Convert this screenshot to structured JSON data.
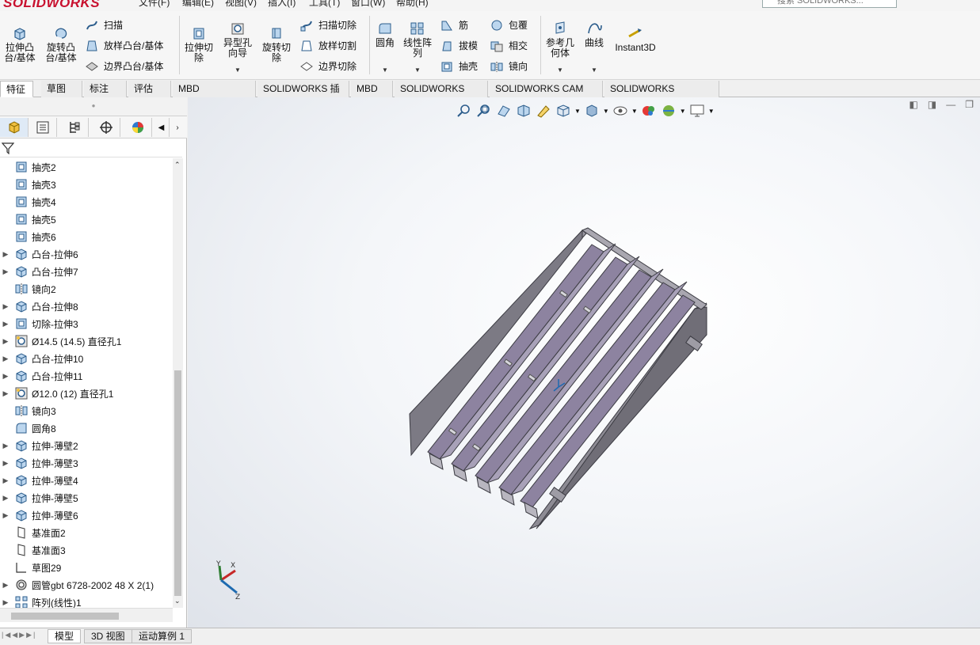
{
  "app": {
    "logo_text": "SOLIDWORKS"
  },
  "menu": {
    "items": [
      "文件(F)",
      "编辑(E)",
      "视图(V)",
      "插入(I)",
      "工具(T)",
      "窗口(W)",
      "帮助(H)"
    ]
  },
  "search": {
    "placeholder": "搜索 SOLIDWORKS..."
  },
  "ribbon": {
    "extrude_boss": "拉伸凸台/基体",
    "revolve_boss": "旋转凸台/基体",
    "sweep": "扫描",
    "loft_boss": "放样凸台/基体",
    "boundary_boss": "边界凸台/基体",
    "extrude_cut": "拉伸切除",
    "hole_wizard": "异型孔向导",
    "revolve_cut": "旋转切除",
    "sweep_cut": "扫描切除",
    "loft_cut": "放样切割",
    "boundary_cut": "边界切除",
    "fillet": "圆角",
    "linear_pattern": "线性阵列",
    "rib": "筋",
    "draft": "拔模",
    "shell": "抽壳",
    "wrap": "包覆",
    "intersect": "相交",
    "mirror": "镜向",
    "ref_geometry": "参考几何体",
    "curves": "曲线",
    "instant3d": "Instant3D"
  },
  "tabs": [
    "特征",
    "草图",
    "标注",
    "评估",
    "MBD Dimensions",
    "SOLIDWORKS 插件",
    "MBD",
    "SOLIDWORKS CAM",
    "SOLIDWORKS CAM TBM",
    "SOLIDWORKS Inspection"
  ],
  "tree": {
    "items": [
      {
        "label": "抽壳2",
        "icon": "shell-icon",
        "expandable": false
      },
      {
        "label": "抽壳3",
        "icon": "shell-icon",
        "expandable": false
      },
      {
        "label": "抽壳4",
        "icon": "shell-icon",
        "expandable": false
      },
      {
        "label": "抽壳5",
        "icon": "shell-icon",
        "expandable": false
      },
      {
        "label": "抽壳6",
        "icon": "shell-icon",
        "expandable": false
      },
      {
        "label": "凸台-拉伸6",
        "icon": "extrude-boss-icon",
        "expandable": true
      },
      {
        "label": "凸台-拉伸7",
        "icon": "extrude-boss-icon",
        "expandable": true
      },
      {
        "label": "镜向2",
        "icon": "mirror-icon",
        "expandable": false
      },
      {
        "label": "凸台-拉伸8",
        "icon": "extrude-boss-icon",
        "expandable": true
      },
      {
        "label": "切除-拉伸3",
        "icon": "extrude-cut-icon",
        "expandable": true
      },
      {
        "label": "Ø14.5 (14.5) 直径孔1",
        "icon": "hole-wizard-icon",
        "expandable": true
      },
      {
        "label": "凸台-拉伸10",
        "icon": "extrude-boss-icon",
        "expandable": true
      },
      {
        "label": "凸台-拉伸11",
        "icon": "extrude-boss-icon",
        "expandable": true
      },
      {
        "label": "Ø12.0 (12) 直径孔1",
        "icon": "hole-wizard-icon",
        "expandable": true
      },
      {
        "label": "镜向3",
        "icon": "mirror-icon",
        "expandable": false
      },
      {
        "label": "圆角8",
        "icon": "fillet-icon",
        "expandable": false
      },
      {
        "label": "拉伸-薄壁2",
        "icon": "extrude-boss-icon",
        "expandable": true
      },
      {
        "label": "拉伸-薄壁3",
        "icon": "extrude-boss-icon",
        "expandable": true
      },
      {
        "label": "拉伸-薄壁4",
        "icon": "extrude-boss-icon",
        "expandable": true
      },
      {
        "label": "拉伸-薄壁5",
        "icon": "extrude-boss-icon",
        "expandable": true
      },
      {
        "label": "拉伸-薄壁6",
        "icon": "extrude-boss-icon",
        "expandable": true
      },
      {
        "label": "基准面2",
        "icon": "plane-icon",
        "expandable": false
      },
      {
        "label": "基准面3",
        "icon": "plane-icon",
        "expandable": false
      },
      {
        "label": "草图29",
        "icon": "sketch-icon",
        "expandable": false
      },
      {
        "label": "圆管gbt 6728-2002 48 X 2(1)",
        "icon": "library-part-icon",
        "expandable": true
      },
      {
        "label": "阵列(线性)1",
        "icon": "linear-pattern-icon",
        "expandable": true
      }
    ]
  },
  "bottom_tabs": [
    "模型",
    "3D 视图",
    "运动算例 1"
  ],
  "colors": {
    "accent": "#1e6ab0",
    "model_face": "#a6a3ad",
    "model_inner": "#8d83a0",
    "model_edge": "#3b3b42"
  }
}
